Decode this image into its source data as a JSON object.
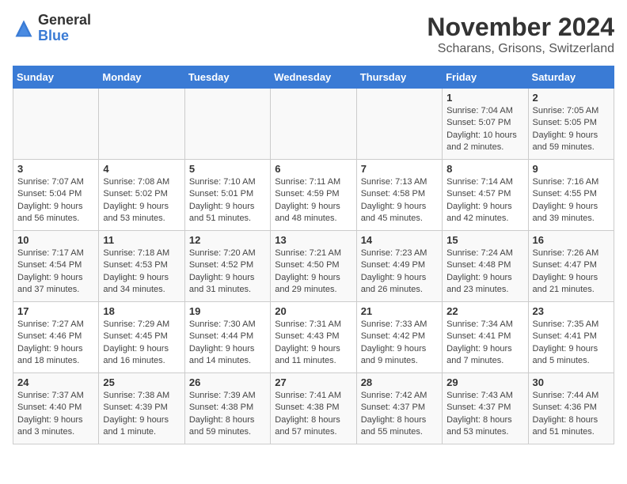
{
  "logo": {
    "general": "General",
    "blue": "Blue"
  },
  "title": "November 2024",
  "subtitle": "Scharans, Grisons, Switzerland",
  "days_of_week": [
    "Sunday",
    "Monday",
    "Tuesday",
    "Wednesday",
    "Thursday",
    "Friday",
    "Saturday"
  ],
  "weeks": [
    [
      {
        "day": "",
        "info": ""
      },
      {
        "day": "",
        "info": ""
      },
      {
        "day": "",
        "info": ""
      },
      {
        "day": "",
        "info": ""
      },
      {
        "day": "",
        "info": ""
      },
      {
        "day": "1",
        "info": "Sunrise: 7:04 AM\nSunset: 5:07 PM\nDaylight: 10 hours and 2 minutes."
      },
      {
        "day": "2",
        "info": "Sunrise: 7:05 AM\nSunset: 5:05 PM\nDaylight: 9 hours and 59 minutes."
      }
    ],
    [
      {
        "day": "3",
        "info": "Sunrise: 7:07 AM\nSunset: 5:04 PM\nDaylight: 9 hours and 56 minutes."
      },
      {
        "day": "4",
        "info": "Sunrise: 7:08 AM\nSunset: 5:02 PM\nDaylight: 9 hours and 53 minutes."
      },
      {
        "day": "5",
        "info": "Sunrise: 7:10 AM\nSunset: 5:01 PM\nDaylight: 9 hours and 51 minutes."
      },
      {
        "day": "6",
        "info": "Sunrise: 7:11 AM\nSunset: 4:59 PM\nDaylight: 9 hours and 48 minutes."
      },
      {
        "day": "7",
        "info": "Sunrise: 7:13 AM\nSunset: 4:58 PM\nDaylight: 9 hours and 45 minutes."
      },
      {
        "day": "8",
        "info": "Sunrise: 7:14 AM\nSunset: 4:57 PM\nDaylight: 9 hours and 42 minutes."
      },
      {
        "day": "9",
        "info": "Sunrise: 7:16 AM\nSunset: 4:55 PM\nDaylight: 9 hours and 39 minutes."
      }
    ],
    [
      {
        "day": "10",
        "info": "Sunrise: 7:17 AM\nSunset: 4:54 PM\nDaylight: 9 hours and 37 minutes."
      },
      {
        "day": "11",
        "info": "Sunrise: 7:18 AM\nSunset: 4:53 PM\nDaylight: 9 hours and 34 minutes."
      },
      {
        "day": "12",
        "info": "Sunrise: 7:20 AM\nSunset: 4:52 PM\nDaylight: 9 hours and 31 minutes."
      },
      {
        "day": "13",
        "info": "Sunrise: 7:21 AM\nSunset: 4:50 PM\nDaylight: 9 hours and 29 minutes."
      },
      {
        "day": "14",
        "info": "Sunrise: 7:23 AM\nSunset: 4:49 PM\nDaylight: 9 hours and 26 minutes."
      },
      {
        "day": "15",
        "info": "Sunrise: 7:24 AM\nSunset: 4:48 PM\nDaylight: 9 hours and 23 minutes."
      },
      {
        "day": "16",
        "info": "Sunrise: 7:26 AM\nSunset: 4:47 PM\nDaylight: 9 hours and 21 minutes."
      }
    ],
    [
      {
        "day": "17",
        "info": "Sunrise: 7:27 AM\nSunset: 4:46 PM\nDaylight: 9 hours and 18 minutes."
      },
      {
        "day": "18",
        "info": "Sunrise: 7:29 AM\nSunset: 4:45 PM\nDaylight: 9 hours and 16 minutes."
      },
      {
        "day": "19",
        "info": "Sunrise: 7:30 AM\nSunset: 4:44 PM\nDaylight: 9 hours and 14 minutes."
      },
      {
        "day": "20",
        "info": "Sunrise: 7:31 AM\nSunset: 4:43 PM\nDaylight: 9 hours and 11 minutes."
      },
      {
        "day": "21",
        "info": "Sunrise: 7:33 AM\nSunset: 4:42 PM\nDaylight: 9 hours and 9 minutes."
      },
      {
        "day": "22",
        "info": "Sunrise: 7:34 AM\nSunset: 4:41 PM\nDaylight: 9 hours and 7 minutes."
      },
      {
        "day": "23",
        "info": "Sunrise: 7:35 AM\nSunset: 4:41 PM\nDaylight: 9 hours and 5 minutes."
      }
    ],
    [
      {
        "day": "24",
        "info": "Sunrise: 7:37 AM\nSunset: 4:40 PM\nDaylight: 9 hours and 3 minutes."
      },
      {
        "day": "25",
        "info": "Sunrise: 7:38 AM\nSunset: 4:39 PM\nDaylight: 9 hours and 1 minute."
      },
      {
        "day": "26",
        "info": "Sunrise: 7:39 AM\nSunset: 4:38 PM\nDaylight: 8 hours and 59 minutes."
      },
      {
        "day": "27",
        "info": "Sunrise: 7:41 AM\nSunset: 4:38 PM\nDaylight: 8 hours and 57 minutes."
      },
      {
        "day": "28",
        "info": "Sunrise: 7:42 AM\nSunset: 4:37 PM\nDaylight: 8 hours and 55 minutes."
      },
      {
        "day": "29",
        "info": "Sunrise: 7:43 AM\nSunset: 4:37 PM\nDaylight: 8 hours and 53 minutes."
      },
      {
        "day": "30",
        "info": "Sunrise: 7:44 AM\nSunset: 4:36 PM\nDaylight: 8 hours and 51 minutes."
      }
    ]
  ]
}
